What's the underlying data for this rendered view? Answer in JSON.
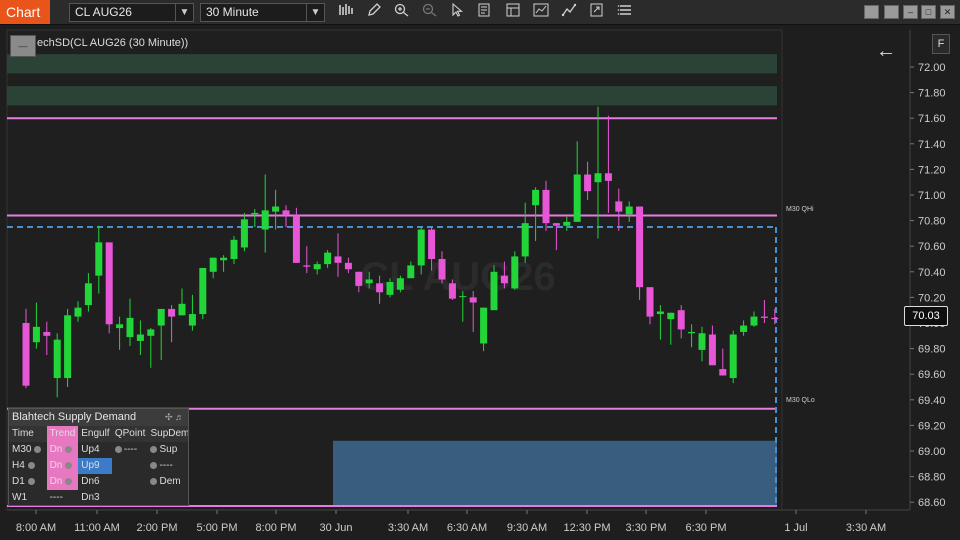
{
  "toolbar": {
    "chart_tab": "Chart",
    "instrument": "CL AUG26",
    "interval": "30 Minute",
    "icons": [
      "bars-icon",
      "pencil-icon",
      "zoom-in-icon",
      "zoom-out-icon",
      "pointer-icon",
      "properties-icon",
      "template-icon",
      "indicators-icon",
      "strategies-icon",
      "export-icon",
      "menu-icon"
    ],
    "window_buttons": [
      "tile-icon",
      "restore-icon",
      "minimize-icon",
      "maximize-icon",
      "close-icon"
    ]
  },
  "chart": {
    "title": "echSD(CL AUG26 (30 Minute))",
    "watermark": "CL AUG26",
    "last_price": "70.03",
    "level_labels": {
      "qhi": "M30 QHi",
      "qlo": "M30 QLo"
    },
    "colors": {
      "up": "#22d63a",
      "down": "#e856d8",
      "level": "#e77ce0",
      "supply": "#2e4a3c",
      "demand": "#3b6488",
      "dashed": "#4a90d0"
    }
  },
  "chart_data": {
    "type": "candlestick",
    "price_axis": [
      "72.00",
      "71.80",
      "71.60",
      "71.40",
      "71.20",
      "71.00",
      "70.80",
      "70.60",
      "70.40",
      "70.20",
      "70.00",
      "69.80",
      "69.60",
      "69.40",
      "69.20",
      "69.00",
      "68.80",
      "68.60"
    ],
    "time_axis": [
      "8:00 AM",
      "11:00 AM",
      "2:00 PM",
      "5:00 PM",
      "8:00 PM",
      "30 Jun",
      "3:30 AM",
      "6:30 AM",
      "9:30 AM",
      "12:30 PM",
      "3:30 PM",
      "6:30 PM",
      "1 Jul",
      "3:30 AM"
    ],
    "ylim": [
      68.5,
      72.2
    ],
    "levels": [
      {
        "name": "M30 QHi",
        "price": 70.84
      },
      {
        "name": "M30 QLo",
        "price": 69.33
      },
      {
        "name": "top",
        "price": 71.6
      },
      {
        "name": "bottom",
        "price": 68.57
      }
    ],
    "zones": [
      {
        "type": "supply",
        "from_price": 72.1,
        "to_price": 71.95,
        "x_start": 0,
        "x_end": 127
      },
      {
        "type": "supply",
        "from_price": 71.85,
        "to_price": 71.7,
        "x_start": 0,
        "x_end": 127
      },
      {
        "type": "supply",
        "from_price": 71.6,
        "to_price": 70.97,
        "x_start": 103,
        "x_end": 127
      },
      {
        "type": "supply",
        "from_price": 70.15,
        "to_price": 69.77,
        "x_start": 111,
        "x_end": 127
      },
      {
        "type": "demand",
        "from_price": 69.67,
        "to_price": 69.2,
        "x_start": 119,
        "x_end": 127
      },
      {
        "type": "demand",
        "from_price": 69.08,
        "to_price": 68.57,
        "x_start": 30,
        "x_end": 127
      }
    ],
    "dashed_level": 70.75,
    "candles": [
      [
        70.0,
        70.11,
        69.49,
        69.51
      ],
      [
        69.85,
        70.16,
        69.8,
        69.97
      ],
      [
        69.93,
        70.01,
        69.75,
        69.9
      ],
      [
        69.57,
        69.92,
        69.42,
        69.87
      ],
      [
        69.57,
        70.11,
        69.5,
        70.06
      ],
      [
        70.05,
        70.17,
        70.01,
        70.12
      ],
      [
        70.14,
        70.39,
        70.09,
        70.31
      ],
      [
        70.37,
        70.76,
        70.23,
        70.63
      ],
      [
        70.63,
        70.56,
        69.92,
        69.99
      ],
      [
        69.96,
        70.05,
        69.79,
        69.99
      ],
      [
        69.89,
        70.19,
        69.82,
        70.04
      ],
      [
        69.86,
        70.02,
        69.75,
        69.91
      ],
      [
        69.9,
        69.96,
        69.65,
        69.95
      ],
      [
        69.98,
        70.07,
        69.71,
        70.11
      ],
      [
        70.11,
        70.14,
        69.85,
        70.05
      ],
      [
        70.06,
        70.27,
        70.06,
        70.15
      ],
      [
        69.98,
        70.22,
        69.94,
        70.07
      ],
      [
        70.07,
        70.43,
        70.03,
        70.43
      ],
      [
        70.4,
        70.51,
        70.35,
        70.51
      ],
      [
        70.49,
        70.53,
        70.4,
        70.51
      ],
      [
        70.5,
        70.68,
        70.46,
        70.65
      ],
      [
        70.59,
        70.86,
        70.56,
        70.81
      ],
      [
        70.85,
        70.89,
        70.75,
        70.86
      ],
      [
        70.73,
        71.16,
        70.55,
        70.88
      ],
      [
        70.87,
        71.04,
        70.73,
        70.91
      ],
      [
        70.88,
        70.92,
        70.75,
        70.84
      ],
      [
        70.84,
        70.9,
        70.47,
        70.47
      ],
      [
        70.45,
        70.6,
        70.39,
        70.44
      ],
      [
        70.42,
        70.48,
        70.38,
        70.46
      ],
      [
        70.46,
        70.57,
        70.43,
        70.55
      ],
      [
        70.52,
        70.7,
        70.36,
        70.47
      ],
      [
        70.47,
        70.51,
        70.39,
        70.42
      ],
      [
        70.4,
        70.4,
        70.24,
        70.29
      ],
      [
        70.31,
        70.4,
        70.27,
        70.34
      ],
      [
        70.31,
        70.37,
        70.15,
        70.24
      ],
      [
        70.22,
        70.35,
        70.2,
        70.32
      ],
      [
        70.26,
        70.37,
        70.24,
        70.35
      ],
      [
        70.35,
        70.48,
        70.35,
        70.45
      ],
      [
        70.45,
        70.75,
        70.38,
        70.73
      ],
      [
        70.73,
        70.75,
        70.41,
        70.5
      ],
      [
        70.5,
        70.56,
        70.31,
        70.34
      ],
      [
        70.31,
        70.34,
        70.18,
        70.19
      ],
      [
        70.21,
        70.25,
        70.01,
        70.21
      ],
      [
        70.2,
        70.25,
        69.93,
        70.16
      ],
      [
        69.84,
        70.12,
        69.78,
        70.12
      ],
      [
        70.1,
        70.45,
        70.12,
        70.4
      ],
      [
        70.37,
        70.48,
        70.27,
        70.31
      ],
      [
        70.27,
        70.56,
        70.26,
        70.52
      ],
      [
        70.52,
        70.94,
        70.47,
        70.78
      ],
      [
        70.92,
        71.06,
        70.64,
        71.04
      ],
      [
        71.04,
        71.11,
        70.72,
        70.78
      ],
      [
        70.78,
        70.78,
        70.57,
        70.76
      ],
      [
        70.76,
        70.83,
        70.72,
        70.79
      ],
      [
        70.79,
        71.42,
        70.79,
        71.16
      ],
      [
        71.16,
        71.26,
        70.96,
        71.03
      ],
      [
        71.1,
        71.69,
        70.66,
        71.17
      ],
      [
        71.17,
        71.62,
        70.86,
        71.11
      ],
      [
        70.95,
        71.05,
        70.72,
        70.87
      ],
      [
        70.85,
        70.95,
        70.79,
        70.91
      ],
      [
        70.91,
        70.85,
        70.18,
        70.28
      ],
      [
        70.28,
        70.25,
        69.99,
        70.05
      ],
      [
        70.07,
        70.14,
        69.87,
        70.09
      ],
      [
        70.03,
        70.08,
        69.83,
        70.08
      ],
      [
        70.1,
        70.14,
        69.88,
        69.95
      ],
      [
        69.92,
        69.99,
        69.81,
        69.93
      ],
      [
        69.79,
        69.97,
        69.7,
        69.92
      ],
      [
        69.91,
        69.98,
        69.67,
        69.67
      ],
      [
        69.64,
        69.8,
        69.59,
        69.59
      ],
      [
        69.57,
        69.94,
        69.53,
        69.91
      ],
      [
        69.93,
        70.02,
        69.9,
        69.98
      ],
      [
        69.98,
        70.09,
        69.97,
        70.05
      ],
      [
        70.05,
        70.18,
        70.0,
        70.04
      ],
      [
        70.04,
        70.11,
        69.99,
        70.03
      ]
    ],
    "table": {
      "title": "Blahtech Supply Demand",
      "headers": [
        "Time",
        "Trend",
        "Engulf",
        "QPoint",
        "SupDem"
      ],
      "rows": [
        [
          "M30",
          "Dn",
          "Up4",
          "----",
          "Sup"
        ],
        [
          "H4",
          "Dn",
          "Up9",
          "",
          "----"
        ],
        [
          "D1",
          "Dn",
          "Dn6",
          "",
          "Dem"
        ],
        [
          "W1",
          "----",
          "Dn3",
          "",
          ""
        ]
      ]
    }
  }
}
